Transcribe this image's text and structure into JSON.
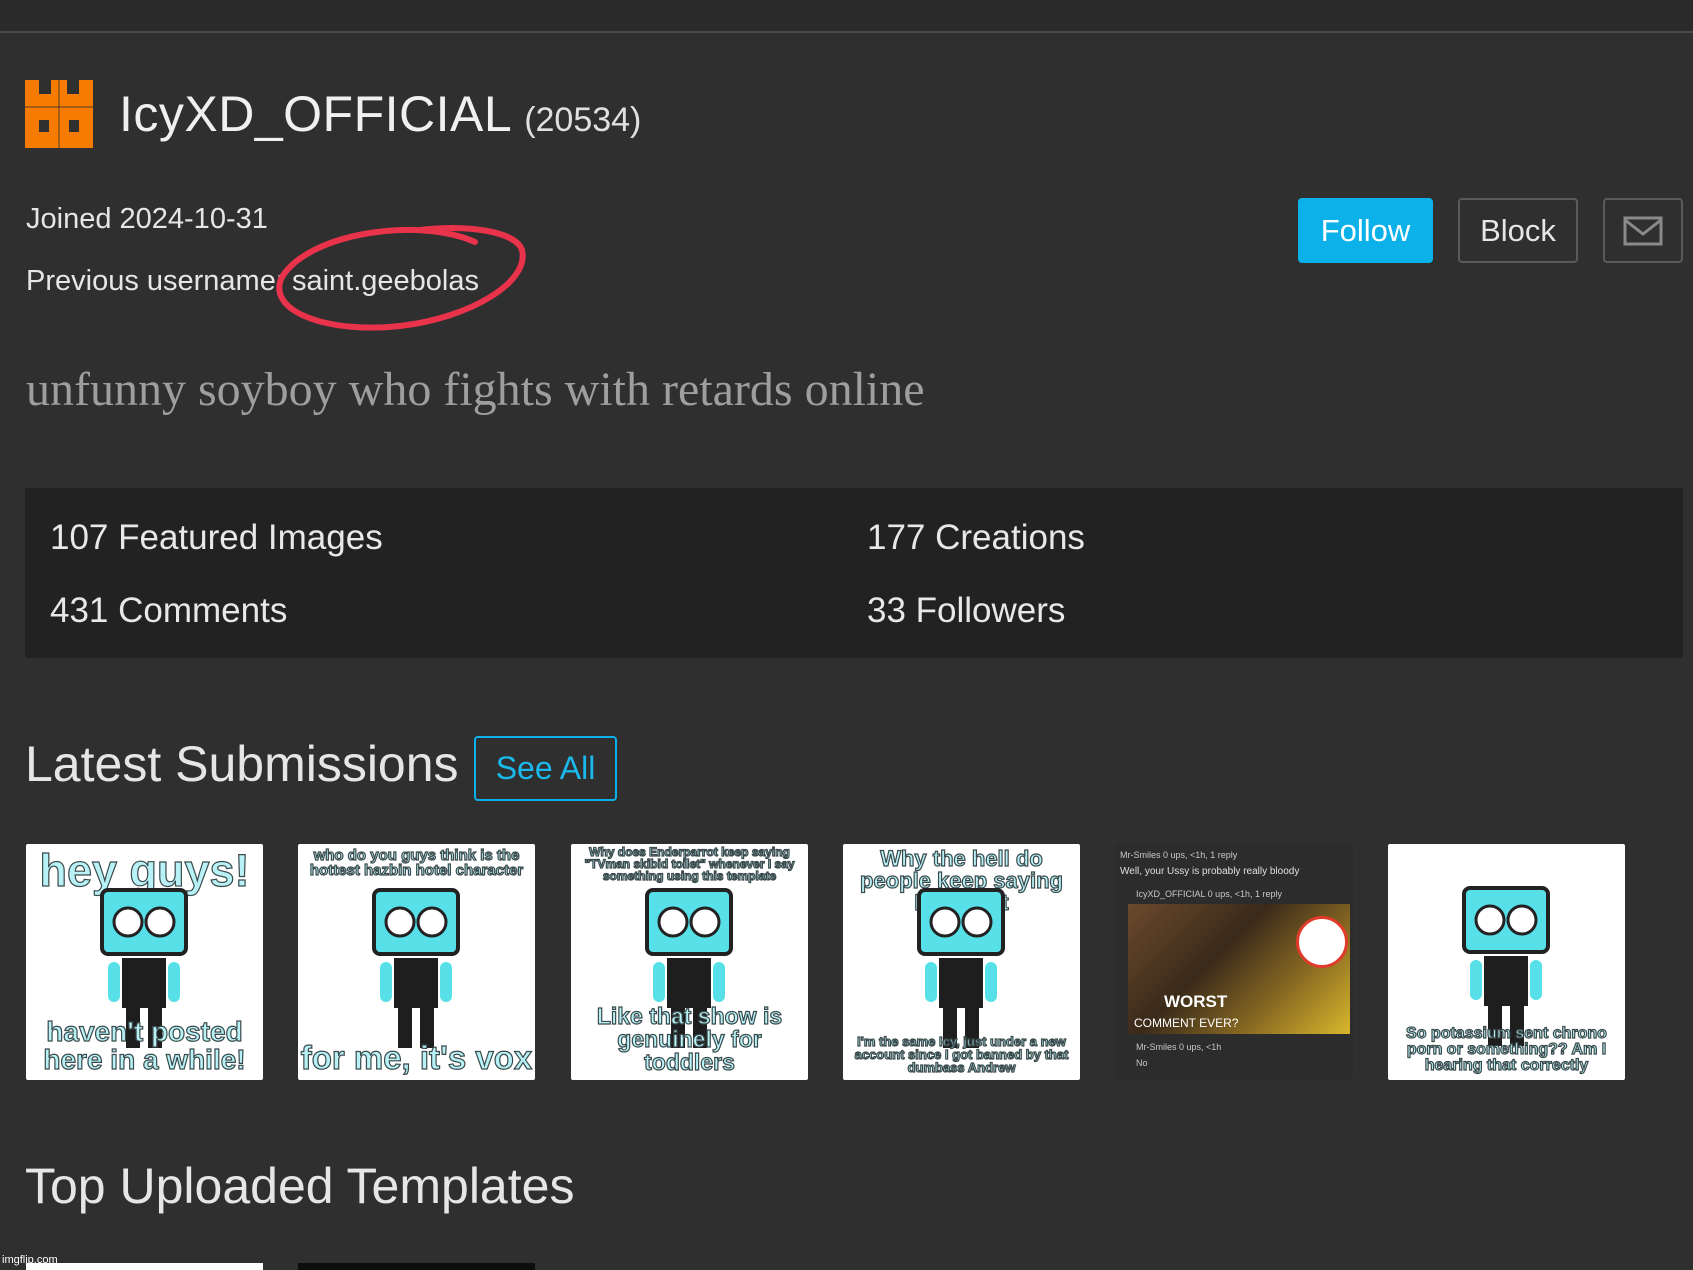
{
  "profile": {
    "username": "IcyXD_OFFICIAL",
    "user_id": "(20534)",
    "joined": "Joined 2024-10-31",
    "previous_username": "Previous username: saint.geebolas",
    "bio": "unfunny soyboy who fights with retards online",
    "logo_color": "#f57c00"
  },
  "actions": {
    "follow_label": "Follow",
    "block_label": "Block",
    "message_icon": "mail-icon",
    "accent_color": "#0bb1e8"
  },
  "stats": {
    "featured": "107 Featured Images",
    "creations": "177 Creations",
    "comments": "431 Comments",
    "followers": "33 Followers"
  },
  "latest": {
    "title": "Latest Submissions",
    "see_all_label": "See All",
    "thumbnails": [
      {
        "top": "hey guys!",
        "bottom": "haven't posted here in a while!"
      },
      {
        "top": "who do you guys think is the hottest hazbin hotel character",
        "bottom": "for me, it's vox"
      },
      {
        "top": "Why does Enderparrot keep saying \"TVman skibid toilet\" whenever I say something using this template",
        "bottom": "Like that show is genuinely for toddlers"
      },
      {
        "top": "Why the hell do people keep saying I'm an alt",
        "bottom": "I'm the same Icy, just under a new account since I got banned by that dumbass Andrew"
      },
      {
        "line1": "Mr-Smiles 0 ups, <1h, 1 reply",
        "line2": "Well, your Ussy is probably really bloody",
        "line3": "IcyXD_OFFICIAL 0 ups, <1h, 1 reply",
        "worst": "WORST",
        "comment_ever": "COMMENT EVER?",
        "line4": "Mr-Smiles 0 ups, <1h",
        "line5": "No"
      },
      {
        "top": "",
        "bottom": "So potassium sent chrono porn or something?? Am I hearing that correctly"
      }
    ]
  },
  "templates": {
    "title": "Top Uploaded Templates"
  },
  "watermark": "imgflip.com"
}
